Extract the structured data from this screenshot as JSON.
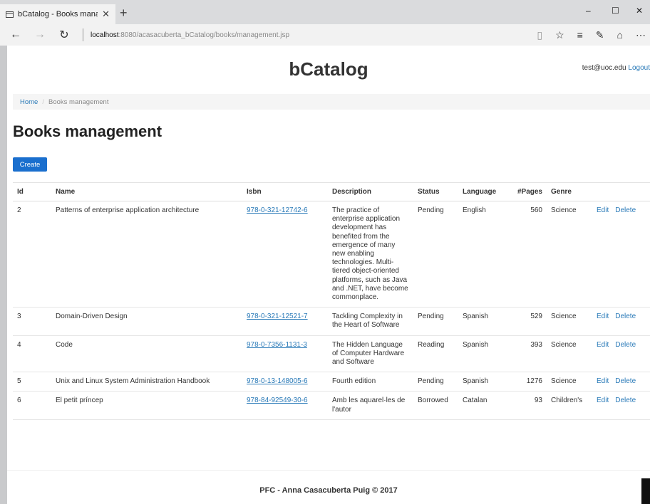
{
  "browser": {
    "tab_title": "bCatalog - Books mana",
    "url_host": "localhost",
    "url_path": ":8080/acasacuberta_bCatalog/books/management.jsp"
  },
  "site": {
    "title": "bCatalog",
    "user_email": "test@uoc.edu",
    "logout_label": "Logout"
  },
  "breadcrumb": {
    "home": "Home",
    "separator": "/",
    "current": "Books management"
  },
  "page": {
    "heading": "Books management",
    "create_label": "Create"
  },
  "table": {
    "headers": [
      "Id",
      "Name",
      "Isbn",
      "Description",
      "Status",
      "Language",
      "#Pages",
      "Genre"
    ],
    "edit_label": "Edit",
    "delete_label": "Delete",
    "rows": [
      {
        "id": "2",
        "name": "Patterns of enterprise application architecture",
        "isbn": "978-0-321-12742-6",
        "description": "The practice of enterprise application development has benefited from the emergence of many new enabling technologies. Multi-tiered object-oriented platforms, such as Java and .NET, have become commonplace.",
        "status": "Pending",
        "language": "English",
        "pages": "560",
        "genre": "Science"
      },
      {
        "id": "3",
        "name": "Domain-Driven Design",
        "isbn": "978-0-321-12521-7",
        "description": "Tackling Complexity in the Heart of Software",
        "status": "Pending",
        "language": "Spanish",
        "pages": "529",
        "genre": "Science"
      },
      {
        "id": "4",
        "name": "Code",
        "isbn": "978-0-7356-1131-3",
        "description": "The Hidden Language of Computer Hardware and Software",
        "status": "Reading",
        "language": "Spanish",
        "pages": "393",
        "genre": "Science"
      },
      {
        "id": "5",
        "name": "Unix and Linux System Administration Handbook",
        "isbn": "978-0-13-148005-6",
        "description": "Fourth edition",
        "status": "Pending",
        "language": "Spanish",
        "pages": "1276",
        "genre": "Science"
      },
      {
        "id": "6",
        "name": "El petit príncep",
        "isbn": "978-84-92549-30-6",
        "description": "Amb les aquarel·les de l'autor",
        "status": "Borrowed",
        "language": "Catalan",
        "pages": "93",
        "genre": "Children's"
      }
    ]
  },
  "footer": {
    "text": "PFC - Anna Casacuberta Puig © 2017"
  }
}
